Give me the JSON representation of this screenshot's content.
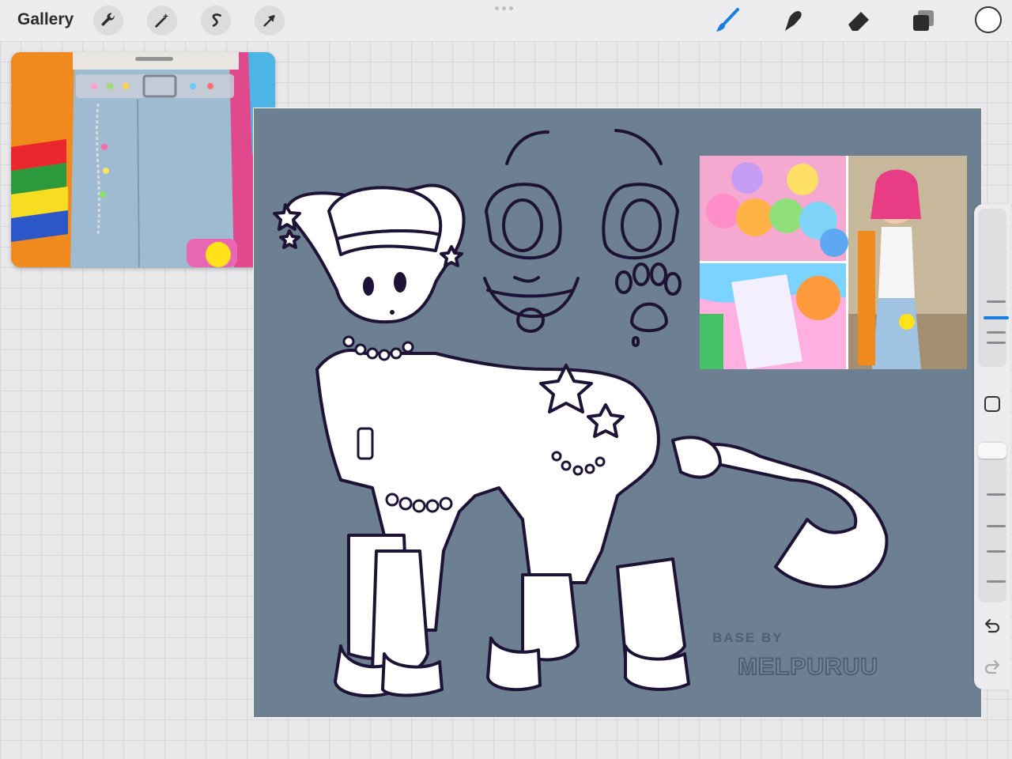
{
  "topbar": {
    "gallery_label": "Gallery",
    "tools_left": [
      {
        "name": "actions",
        "icon": "wrench-icon"
      },
      {
        "name": "adjustments",
        "icon": "magic-wand-icon"
      },
      {
        "name": "selection",
        "icon": "selection-s-icon"
      },
      {
        "name": "transform",
        "icon": "arrow-cursor-icon"
      }
    ],
    "tools_right": [
      {
        "name": "brush",
        "icon": "brush-icon",
        "active": true
      },
      {
        "name": "smudge",
        "icon": "smudge-icon"
      },
      {
        "name": "eraser",
        "icon": "eraser-icon"
      },
      {
        "name": "layers",
        "icon": "layers-icon"
      }
    ],
    "current_color": "#ffffff",
    "accent_color": "#1a7ee0"
  },
  "canvas": {
    "background_color": "#6c8091",
    "line_color": "#1e1236",
    "watermark": {
      "line1": "BASE BY",
      "line2": "MELPURUU"
    }
  },
  "sidebar": {
    "brush_size_level": 0.45,
    "opacity_level": 1.0,
    "modify_button_icon": "square-icon",
    "undo_icon": "undo-icon",
    "redo_icon": "redo-icon"
  }
}
